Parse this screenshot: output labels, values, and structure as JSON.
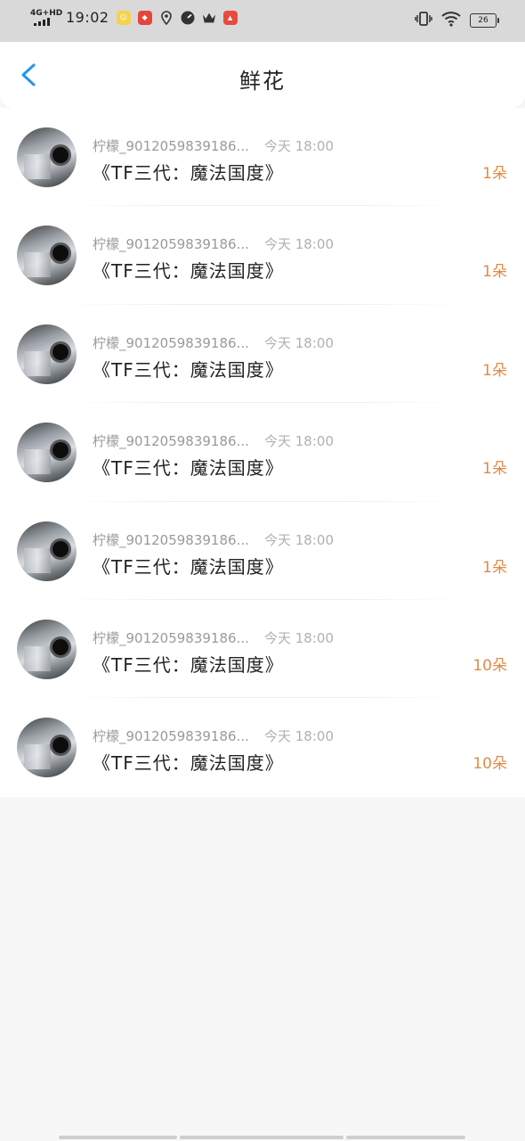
{
  "status_bar": {
    "network": "4G+HD",
    "time": "19:02",
    "battery": "26"
  },
  "header": {
    "title": "鲜花"
  },
  "gifts": [
    {
      "name": "柠檬_9012059839186...",
      "time": "今天 18:00",
      "content": "《TF三代：魔法国度》",
      "count": "1朵"
    },
    {
      "name": "柠檬_9012059839186...",
      "time": "今天 18:00",
      "content": "《TF三代：魔法国度》",
      "count": "1朵"
    },
    {
      "name": "柠檬_9012059839186...",
      "time": "今天 18:00",
      "content": "《TF三代：魔法国度》",
      "count": "1朵"
    },
    {
      "name": "柠檬_9012059839186...",
      "time": "今天 18:00",
      "content": "《TF三代：魔法国度》",
      "count": "1朵"
    },
    {
      "name": "柠檬_9012059839186...",
      "time": "今天 18:00",
      "content": "《TF三代：魔法国度》",
      "count": "1朵"
    },
    {
      "name": "柠檬_9012059839186...",
      "time": "今天 18:00",
      "content": "《TF三代：魔法国度》",
      "count": "10朵"
    },
    {
      "name": "柠檬_9012059839186...",
      "time": "今天 18:00",
      "content": "《TF三代：魔法国度》",
      "count": "10朵"
    }
  ],
  "colors": {
    "accent_back": "#2196F3",
    "count": "#E38A45",
    "status_bar_bg": "#D9D9D9"
  },
  "icons": [
    "back-arrow-icon",
    "vibrate-icon",
    "wifi-icon",
    "battery-icon",
    "signal-icon"
  ]
}
